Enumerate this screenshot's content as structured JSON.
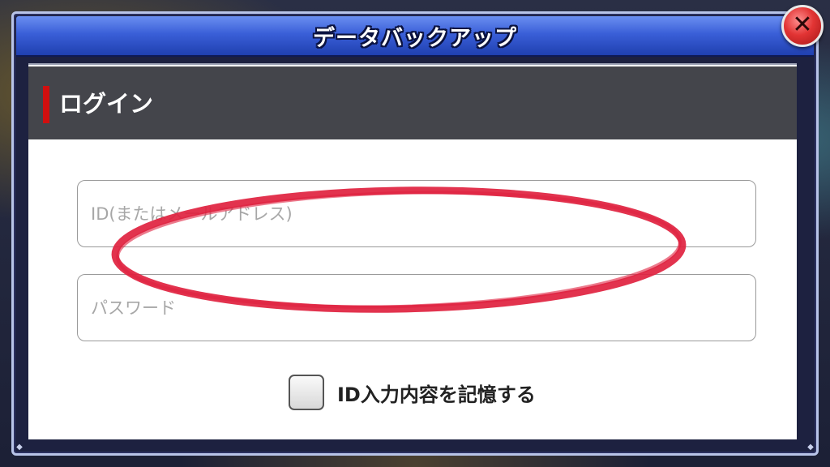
{
  "dialog": {
    "title": "データバックアップ",
    "close_symbol": "✕"
  },
  "section": {
    "title": "ログイン",
    "accent_color": "#d10f0f"
  },
  "form": {
    "id_placeholder": "ID(またはメールアドレス)",
    "id_value": "",
    "password_placeholder": "パスワード",
    "password_value": "",
    "remember_label": "ID入力内容を記憶する",
    "remember_checked": false
  },
  "annotation": {
    "shape": "ellipse",
    "color": "#e0223f"
  },
  "colors": {
    "title_bar": "#3a5fd8",
    "header_bg": "#44454b",
    "close_button": "#e23434"
  },
  "icons": {
    "close": "close-icon",
    "checkbox": "checkbox-icon",
    "corner": "corner-ornament-icon"
  }
}
